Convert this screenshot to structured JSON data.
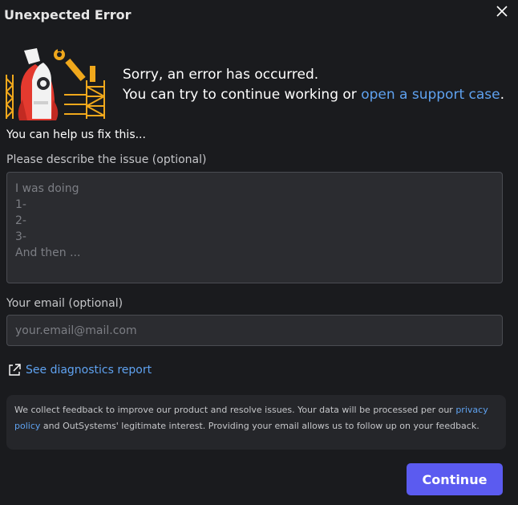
{
  "dialog": {
    "title": "Unexpected Error",
    "close_icon": "close-icon"
  },
  "message": {
    "line1": "Sorry, an error has occurred.",
    "line2_prefix": "You can try to continue working or ",
    "support_link": "open a support case",
    "line2_suffix": "."
  },
  "form": {
    "help_heading": "You can help us fix this...",
    "issue_label": "Please describe the issue (optional)",
    "issue_placeholder": "I was doing\n1-\n2-\n3-\nAnd then ...",
    "issue_value": "",
    "email_label": "Your email (optional)",
    "email_placeholder": "your.email@mail.com",
    "email_value": ""
  },
  "diagnostics": {
    "icon": "external-link-icon",
    "label": "See diagnostics report"
  },
  "notice": {
    "text_before": "We collect feedback to improve our product and resolve issues. Your data will be processed per our ",
    "privacy_link": "privacy policy",
    "text_after": " and OutSystems' legitimate interest. Providing your email allows us to follow up on your feedback."
  },
  "actions": {
    "continue_label": "Continue"
  },
  "colors": {
    "background": "#1a1b1e",
    "link": "#5fa2f0",
    "accent_button": "#5b5bf0",
    "field_background": "#2b2c30"
  }
}
